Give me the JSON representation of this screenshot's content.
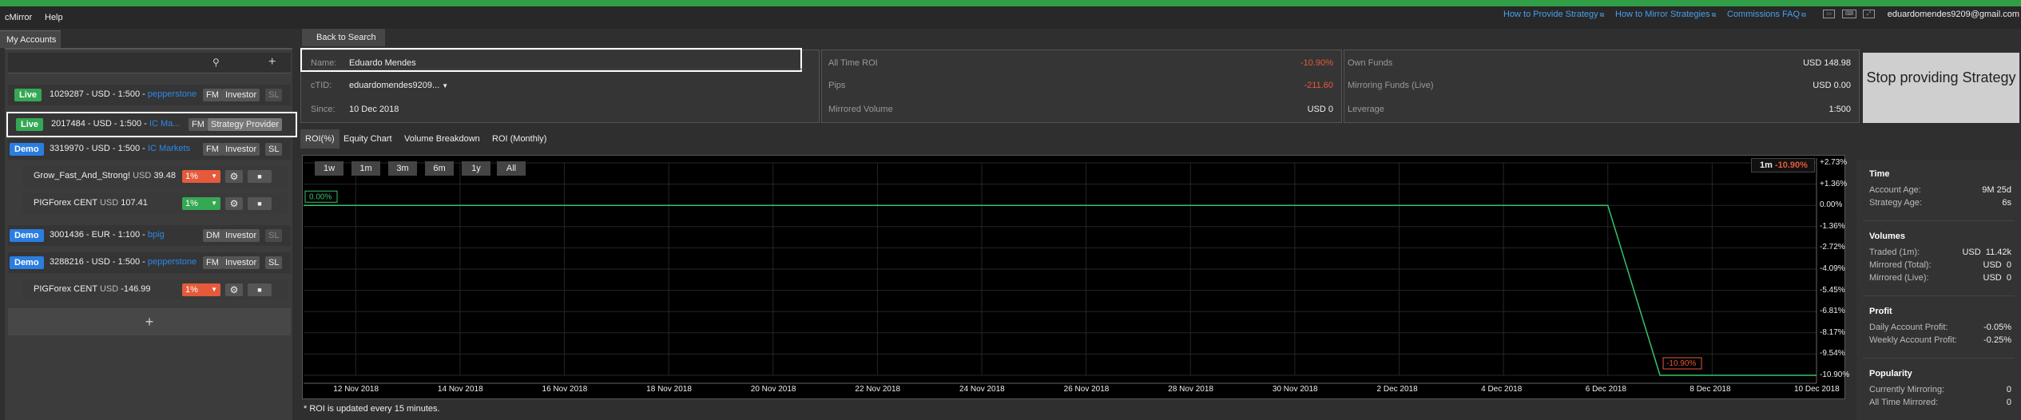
{
  "menu": {
    "app": "cMirror",
    "help": "Help"
  },
  "header": {
    "links": [
      "How to Provide Strategy",
      "How to Mirror Strategies",
      "Commissions FAQ"
    ],
    "email": "eduardomendes9209@gmail.com"
  },
  "sidebar": {
    "tab": "My Accounts",
    "add": "+",
    "accounts": [
      {
        "type": "Live",
        "text": "1029287 - USD - 1:500 - ",
        "broker": "pepperstone",
        "tags": [
          "FM",
          "Investor",
          "SL"
        ]
      },
      {
        "type": "Live",
        "text": "2017484 - USD - 1:500 - ",
        "broker": "IC Ma...",
        "tags": [
          "FM",
          "Strategy Provider"
        ]
      },
      {
        "type": "Demo",
        "text": "3319970 - USD - 1:500 - ",
        "broker": "IC Markets",
        "tags": [
          "FM",
          "Investor",
          "SL"
        ]
      },
      {
        "type": "Demo",
        "text": "3001436 - EUR - 1:100 - ",
        "broker": "bpig",
        "tags": [
          "DM",
          "Investor",
          "SL"
        ]
      },
      {
        "type": "Demo",
        "text": "3288216 - USD - 1:500 - ",
        "broker": "pepperstone",
        "tags": [
          "FM",
          "Investor",
          "SL"
        ]
      }
    ],
    "subs": [
      {
        "name": "Grow_Fast_And_Strong!",
        "cur": "USD",
        "val": "39.48",
        "pct": "1%"
      },
      {
        "name": "PIGForex CENT",
        "cur": "USD",
        "val": "107.41",
        "pct": "1%"
      },
      {
        "name": "PIGForex CENT",
        "cur": "USD",
        "val": "-146.99",
        "pct": "1%"
      }
    ]
  },
  "back": "Back to Search",
  "info": {
    "name_label": "Name:",
    "name": "Eduardo Mendes",
    "ctid_label": "cTID:",
    "ctid": "eduardomendes9209...",
    "since_label": "Since:",
    "since": "10 Dec 2018",
    "roi_label": "All Time ROI",
    "roi": "-10.90%",
    "pips_label": "Pips",
    "pips": "-211.60",
    "mvol_label": "Mirrored Volume",
    "mvol": "USD 0",
    "own_label": "Own Funds",
    "own": "USD 148.98",
    "mf_label": "Mirroring Funds (Live)",
    "mf": "USD 0.00",
    "lev_label": "Leverage",
    "lev": "1:500"
  },
  "stop_button": "Stop providing Strategy",
  "chart_tabs": [
    "ROI(%)",
    "Equity Chart",
    "Volume Breakdown",
    "ROI (Monthly)"
  ],
  "ranges": [
    "1w",
    "1m",
    "3m",
    "6m",
    "1y",
    "All"
  ],
  "chart_data": {
    "type": "line",
    "y_ticks": [
      "+2.73%",
      "+1.36%",
      "0.00%",
      "-1.36%",
      "-2.72%",
      "-4.09%",
      "-5.45%",
      "-6.81%",
      "-8.17%",
      "-9.54%",
      "-10.90%"
    ],
    "ylim": [
      -10.9,
      2.73
    ],
    "x_ticks": [
      "12 Nov 2018",
      "14 Nov 2018",
      "16 Nov 2018",
      "18 Nov 2018",
      "20 Nov 2018",
      "22 Nov 2018",
      "24 Nov 2018",
      "26 Nov 2018",
      "28 Nov 2018",
      "30 Nov 2018",
      "2 Dec 2018",
      "4 Dec 2018",
      "6 Dec 2018",
      "8 Dec 2018",
      "10 Dec 2018"
    ],
    "xlim": [
      "2018-11-11",
      "2018-12-10"
    ],
    "series": [
      {
        "x": [
          "2018-11-11",
          "2018-12-06",
          "2018-12-07",
          "2018-12-10"
        ],
        "y": [
          0.0,
          0.0,
          -10.9,
          -10.9
        ]
      }
    ],
    "start_label": "0.00%",
    "end_label": "-10.90%",
    "period_label": "1m",
    "period_value": "-10.90%",
    "line_color": "#34c46a",
    "grid": true
  },
  "note": "* ROI is updated every 15 minutes.",
  "stats": {
    "time": {
      "title": "Time",
      "rows": [
        [
          "Account Age:",
          "9M 25d"
        ],
        [
          "Strategy Age:",
          "6s"
        ]
      ]
    },
    "volumes": {
      "title": "Volumes",
      "rows": [
        [
          "Traded (1m):",
          "USD  11.42k"
        ],
        [
          "Mirrored (Total):",
          "USD  0"
        ],
        [
          "Mirrored (Live):",
          "USD  0"
        ]
      ]
    },
    "profit": {
      "title": "Profit",
      "rows": [
        [
          "Daily Account Profit:",
          "-0.05%"
        ],
        [
          "Weekly Account Profit:",
          "-0.25%"
        ]
      ]
    },
    "popularity": {
      "title": "Popularity",
      "rows": [
        [
          "Currently Mirroring:",
          "0"
        ],
        [
          "All Time Mirrored:",
          "0"
        ]
      ]
    }
  }
}
